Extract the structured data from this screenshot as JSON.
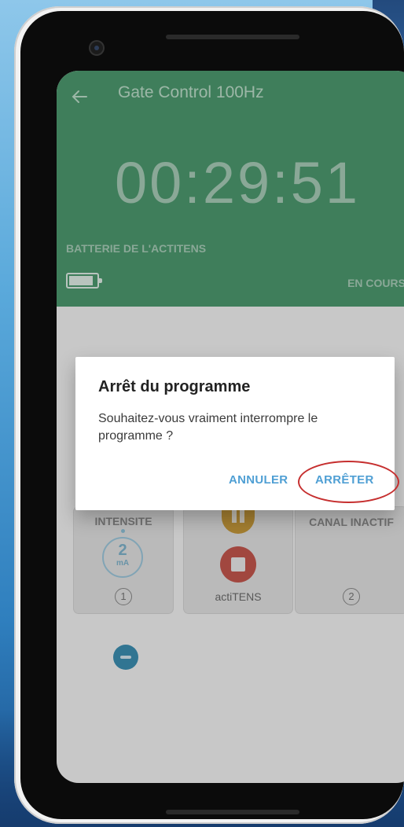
{
  "header": {
    "title": "Gate Control 100Hz",
    "timer": "00:29:51",
    "battery_label": "BATTERIE DE L'ACTITENS",
    "status": "EN COURS"
  },
  "controls": {
    "left_card_label": "INTENSITE",
    "intensity_value": "2",
    "intensity_unit": "mA",
    "channel_1": "1",
    "device_name": "actiTENS",
    "right_card_label": "CANAL INACTIF",
    "channel_2": "2"
  },
  "dialog": {
    "title": "Arrêt du programme",
    "message": "Souhaitez-vous vraiment interrompre le programme ?",
    "cancel_label": "ANNULER",
    "stop_label": "ARRÊTER"
  },
  "colors": {
    "header_green": "#4d9a6f",
    "accent_blue": "#4f9fd4",
    "pause_orange": "#c79a3b",
    "stop_red": "#c5574e",
    "highlight_red": "#c62f2f"
  },
  "icons": {
    "back": "arrow-left-icon",
    "battery": "battery-icon",
    "pause": "pause-icon",
    "stop": "stop-icon",
    "minus": "minus-icon"
  }
}
